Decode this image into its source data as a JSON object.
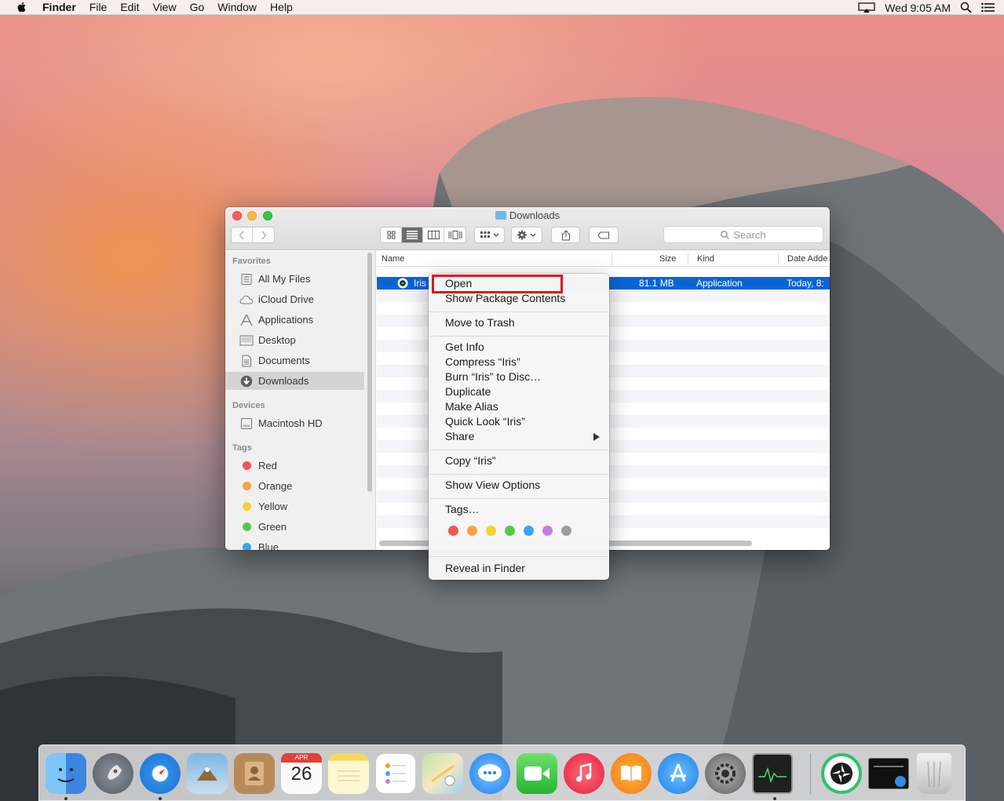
{
  "menubar": {
    "app_name": "Finder",
    "items": [
      "File",
      "Edit",
      "View",
      "Go",
      "Window",
      "Help"
    ],
    "clock": "Wed 9:05 AM",
    "icons": [
      "apple-icon",
      "airplay-icon",
      "spotlight-icon",
      "notification-center-icon"
    ]
  },
  "window": {
    "title": "Downloads",
    "search_placeholder": "Search",
    "sidebar": {
      "favorites_header": "Favorites",
      "favorites": [
        {
          "label": "All My Files",
          "icon": "all-files-icon"
        },
        {
          "label": "iCloud Drive",
          "icon": "cloud-icon"
        },
        {
          "label": "Applications",
          "icon": "applications-icon"
        },
        {
          "label": "Desktop",
          "icon": "desktop-icon"
        },
        {
          "label": "Documents",
          "icon": "documents-icon"
        },
        {
          "label": "Downloads",
          "icon": "downloads-icon",
          "selected": true
        }
      ],
      "devices_header": "Devices",
      "devices": [
        {
          "label": "Macintosh HD",
          "icon": "hard-drive-icon"
        }
      ],
      "tags_header": "Tags",
      "tags": [
        {
          "label": "Red",
          "color": "#f4554d"
        },
        {
          "label": "Orange",
          "color": "#f8a23c"
        },
        {
          "label": "Yellow",
          "color": "#f7cf36"
        },
        {
          "label": "Green",
          "color": "#5ac54b"
        },
        {
          "label": "Blue",
          "color": "#3aa3f4"
        }
      ]
    },
    "columns": {
      "name": "Name",
      "size": "Size",
      "kind": "Kind",
      "date": "Date Adde"
    },
    "files": [
      {
        "name": "Iris",
        "size": "81.1 MB",
        "kind": "Application",
        "date": "Today, 8:"
      }
    ]
  },
  "context_menu": {
    "open": "Open",
    "show_package": "Show Package Contents",
    "move_trash": "Move to Trash",
    "get_info": "Get Info",
    "compress": "Compress “Iris”",
    "burn": "Burn “Iris” to Disc…",
    "duplicate": "Duplicate",
    "make_alias": "Make Alias",
    "quick_look": "Quick Look “Iris”",
    "share": "Share",
    "copy": "Copy “Iris”",
    "view_options": "Show View Options",
    "tags": "Tags…",
    "tag_colors": [
      "#f4554d",
      "#f8a23c",
      "#f7cf36",
      "#5ac54b",
      "#3aa3f4",
      "#c47ddc",
      "#9e9e9e"
    ],
    "reveal": "Reveal in Finder"
  },
  "dock": {
    "apps": [
      "finder-icon",
      "launchpad-icon",
      "safari-icon",
      "mail-icon",
      "contacts-icon",
      "calendar-icon",
      "notes-icon",
      "reminders-icon",
      "maps-icon",
      "messages-icon",
      "facetime-icon",
      "itunes-icon",
      "ibooks-icon",
      "app-store-icon",
      "system-preferences-icon",
      "activity-monitor-icon",
      "iris-icon",
      "downloads-stack-icon",
      "trash-icon"
    ],
    "calendar_month": "APR",
    "calendar_day": "26"
  }
}
